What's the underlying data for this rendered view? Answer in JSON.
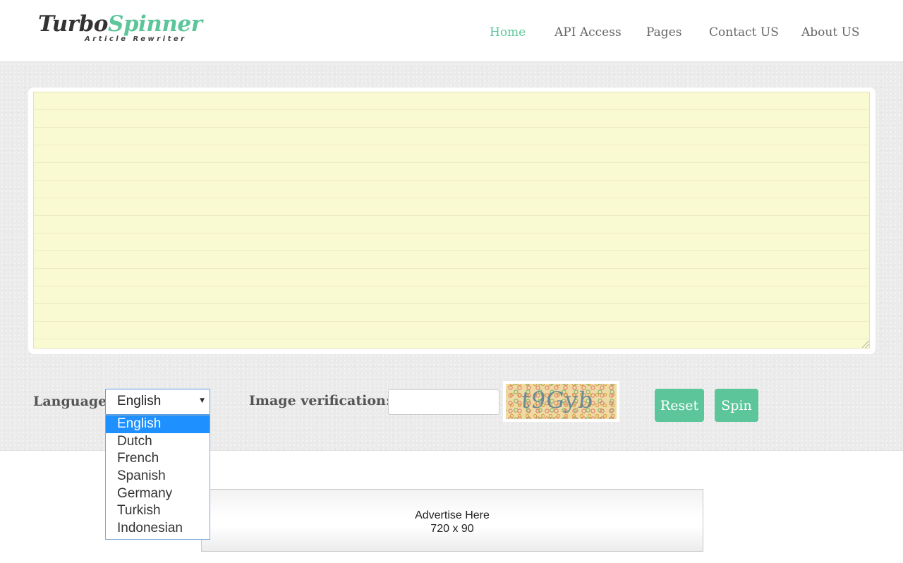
{
  "logo": {
    "word1": "Turbo",
    "word2": "Spinner",
    "tagline": "Article Rewriter"
  },
  "nav": {
    "items": [
      "Home",
      "API Access",
      "Pages",
      "Contact US",
      "About US"
    ],
    "active": "Home"
  },
  "editor": {
    "value": "",
    "background": "#fafad2"
  },
  "form": {
    "language_label": "Language:",
    "language_selected": "English",
    "language_options": [
      "English",
      "Dutch",
      "French",
      "Spanish",
      "Germany",
      "Turkish",
      "Indonesian"
    ],
    "verification_label": "Image verification:",
    "verification_value": "",
    "captcha_text": "t9Gyb",
    "reset_label": "Reset",
    "spin_label": "Spin"
  },
  "ad": {
    "line1": "Advertise Here",
    "line2": "720 x 90"
  },
  "colors": {
    "accent": "#5cc69a",
    "highlight": "#1e90ff"
  }
}
